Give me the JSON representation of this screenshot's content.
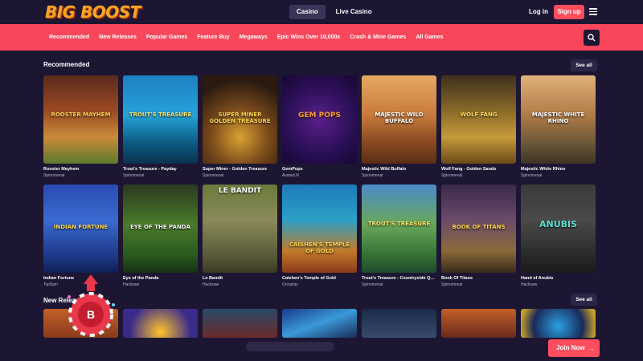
{
  "header": {
    "logo": "BIG BOOST",
    "tabs": [
      {
        "label": "Casino",
        "active": true
      },
      {
        "label": "Live Casino",
        "active": false
      }
    ],
    "login": "Log in",
    "signup": "Sign up"
  },
  "nav": {
    "items": [
      "Recommended",
      "New Releases",
      "Popular Games",
      "Feature Buy",
      "Megaways",
      "Epic Wins Over 10,000x",
      "Crash & Mine Games",
      "All Games"
    ]
  },
  "sections": {
    "recommended": {
      "title": "Recommended",
      "see_all": "See all"
    },
    "new_releases": {
      "title": "New Releases",
      "see_all": "See all"
    }
  },
  "games_row1": [
    {
      "name": "Rooster Mayhem",
      "provider": "Spinomenal",
      "art": "ROOSTER MAYHEM"
    },
    {
      "name": "Trout's Treasure - Payday",
      "provider": "Spinomenal",
      "art": "TROUT'S TREASURE"
    },
    {
      "name": "Super Miner - Golden Treasure",
      "provider": "Spinomenal",
      "art": "SUPER MINER GOLDEN TREASURE"
    },
    {
      "name": "GemPops",
      "provider": "AvatarUX",
      "art": "GEM POPS"
    },
    {
      "name": "Majestic Wild Buffalo",
      "provider": "Spinomenal",
      "art": "MAJESTIC WILD BUFFALO"
    },
    {
      "name": "Wolf Fang - Golden Sands",
      "provider": "Spinomenal",
      "art": "WOLF FANG"
    },
    {
      "name": "Majestic White Rhino",
      "provider": "Spinomenal",
      "art": "MAJESTIC WHITE RHINO"
    }
  ],
  "games_row2": [
    {
      "name": "Indian Fortune",
      "provider": "TopSpin",
      "art": "INDIAN FORTUNE"
    },
    {
      "name": "Eye of the Panda",
      "provider": "Hacksaw",
      "art": "EYE OF THE PANDA"
    },
    {
      "name": "Le Bandit",
      "provider": "Hacksaw",
      "art": "LE BANDIT"
    },
    {
      "name": "Caishen's Temple of Gold",
      "provider": "Octoplay",
      "art": "CAISHEN'S TEMPLE OF GOLD"
    },
    {
      "name": "Trout's Treasure - Countryside Quest",
      "provider": "Spinomenal",
      "art": "TROUT'S TREASURE"
    },
    {
      "name": "Book Of Titans",
      "provider": "Spinomenal",
      "art": "BOOK OF TITANS"
    },
    {
      "name": "Hand of Anubis",
      "provider": "Hacksaw",
      "art": "ANUBIS"
    }
  ],
  "join_button": "Join Now",
  "colors": {
    "background": "#1d1633",
    "accent": "#f8465b",
    "logo": "#f5a623"
  }
}
